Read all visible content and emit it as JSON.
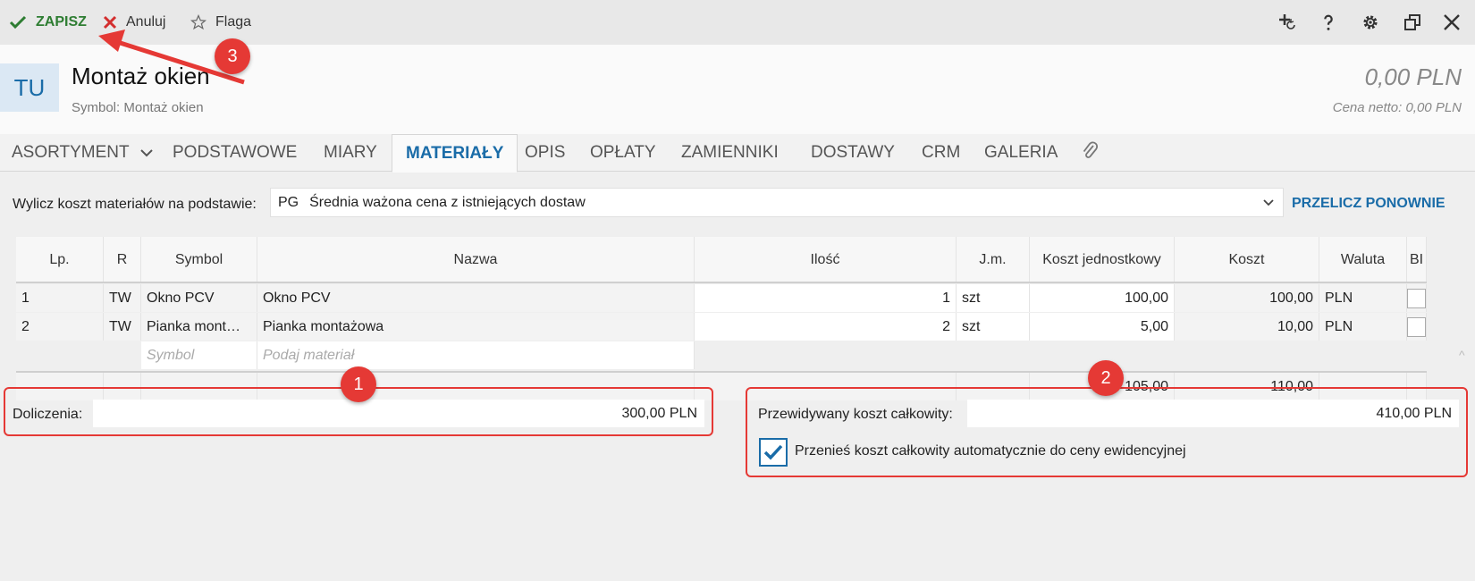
{
  "toolbar": {
    "save": "ZAPISZ",
    "cancel": "Anuluj",
    "flag": "Flaga"
  },
  "header": {
    "badge": "TU",
    "title": "Montaż okien",
    "subtitle": "Symbol: Montaż okien",
    "price": "0,00 PLN",
    "price_net": "Cena netto: 0,00 PLN"
  },
  "tabs": [
    {
      "label": "ASORTYMENT"
    },
    {
      "label": "PODSTAWOWE"
    },
    {
      "label": "MIARY"
    },
    {
      "label": "MATERIAŁY"
    },
    {
      "label": "OPIS"
    },
    {
      "label": "OPŁATY"
    },
    {
      "label": "ZAMIENNIKI"
    },
    {
      "label": "DOSTAWY"
    },
    {
      "label": "CRM"
    },
    {
      "label": "GALERIA"
    }
  ],
  "calc": {
    "label": "Wylicz koszt materiałów na podstawie:",
    "code": "PG",
    "value": "Średnia ważona cena z istniejących dostaw",
    "recalc": "PRZELICZ PONOWNIE"
  },
  "table": {
    "headers": [
      "Lp.",
      "R",
      "Symbol",
      "Nazwa",
      "Ilość",
      "J.m.",
      "Koszt jednostkowy",
      "Koszt",
      "Waluta",
      "BI"
    ],
    "rows": [
      {
        "lp": "1",
        "r": "TW",
        "symbol": "Okno PCV",
        "nazwa": "Okno PCV",
        "ilosc": "1",
        "jm": "szt",
        "koszt_jedn": "100,00",
        "koszt": "100,00",
        "waluta": "PLN"
      },
      {
        "lp": "2",
        "r": "TW",
        "symbol": "Pianka mont…",
        "nazwa": "Pianka montażowa",
        "ilosc": "2",
        "jm": "szt",
        "koszt_jedn": "5,00",
        "koszt": "10,00",
        "waluta": "PLN"
      }
    ],
    "placeholder_symbol": "Symbol",
    "placeholder_material": "Podaj materiał",
    "total_koszt_jedn": "105,00",
    "total_koszt": "110,00"
  },
  "fields": {
    "doliczenia_label": "Doliczenia:",
    "doliczenia_value": "300,00 PLN",
    "przewidywany_label": "Przewidywany koszt całkowity:",
    "przewidywany_value": "410,00 PLN",
    "przenies_label": "Przenieś koszt całkowity automatycznie do ceny ewidencyjnej",
    "przenies_checked": true
  },
  "callouts": [
    "1",
    "2",
    "3"
  ],
  "colors": {
    "accent": "#1a6ca8",
    "save": "#2e7d32",
    "cancel": "#d32f2f",
    "annotation": "#e53935"
  }
}
